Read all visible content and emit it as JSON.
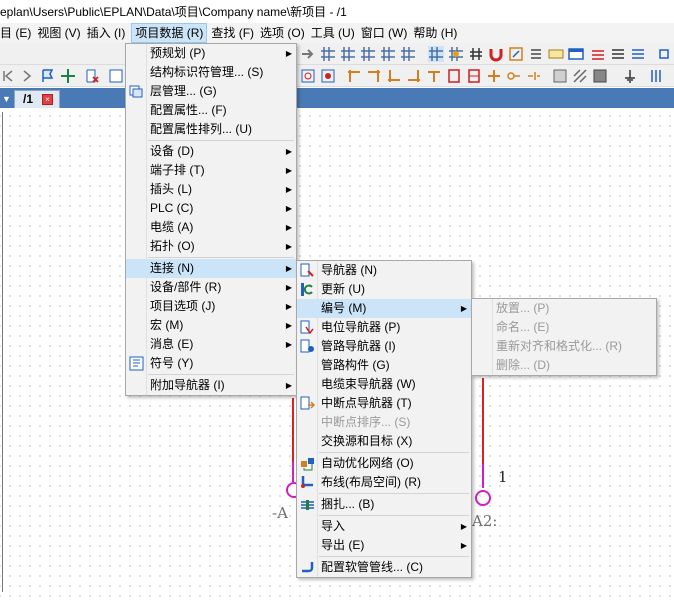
{
  "titlebar": {
    "text": "eplan\\Users\\Public\\EPLAN\\Data\\项目\\Company name\\新项目 - /1"
  },
  "menubar": {
    "items": [
      "目 (E)",
      "视图 (V)",
      "插入 (I)",
      "项目数据 (R)",
      "查找 (F)",
      "选项 (O)",
      "工具 (U)",
      "窗口 (W)",
      "帮助 (H)"
    ]
  },
  "tab": {
    "label": "/1"
  },
  "project_menu": {
    "items": [
      {
        "label": "预规划 (P)",
        "submenu": true
      },
      {
        "label": "结构标识符管理... (S)"
      },
      {
        "label": "层管理... (G)",
        "icon": "layer-icon"
      },
      {
        "label": "配置属性... (F)"
      },
      {
        "label": "配置属性排列... (U)"
      },
      {
        "label": "设备 (D)",
        "submenu": true
      },
      {
        "label": "端子排 (T)",
        "submenu": true
      },
      {
        "label": "插头 (L)",
        "submenu": true
      },
      {
        "label": "PLC (C)",
        "submenu": true
      },
      {
        "label": "电缆 (A)",
        "submenu": true
      },
      {
        "label": "拓扑 (O)",
        "submenu": true
      },
      {
        "label": "连接 (N)",
        "submenu": true
      },
      {
        "label": "设备/部件 (R)",
        "submenu": true
      },
      {
        "label": "项目选项 (J)",
        "submenu": true
      },
      {
        "label": "宏 (M)",
        "submenu": true
      },
      {
        "label": "消息 (E)",
        "submenu": true
      },
      {
        "label": "符号 (Y)",
        "icon": "symbol-icon"
      },
      {
        "label": "附加导航器 (I)",
        "submenu": true
      }
    ]
  },
  "connection_menu": {
    "items": [
      {
        "label": "导航器 (N)",
        "icon": "navigator-icon"
      },
      {
        "label": "更新 (U)",
        "icon": "refresh-icon"
      },
      {
        "label": "编号 (M)",
        "submenu": true
      },
      {
        "label": "电位导航器 (P)",
        "icon": "potential-icon"
      },
      {
        "label": "管路导航器 (I)",
        "icon": "pipe-icon"
      },
      {
        "label": "管路构件 (G)"
      },
      {
        "label": "电缆束导航器 (W)"
      },
      {
        "label": "中断点导航器 (T)",
        "icon": "interruption-icon"
      },
      {
        "label": "中断点排序... (S)",
        "disabled": true
      },
      {
        "label": "交换源和目标 (X)"
      },
      {
        "label": "自动优化网络 (O)",
        "icon": "optimize-icon"
      },
      {
        "label": "布线(布局空间) (R)",
        "icon": "routing-icon"
      },
      {
        "label": "捆扎... (B)",
        "icon": "bundle-icon"
      },
      {
        "label": "导入",
        "submenu": true
      },
      {
        "label": "导出 (E)",
        "submenu": true
      },
      {
        "label": "配置软管管线... (C)",
        "icon": "hose-icon"
      }
    ]
  },
  "numbering_menu": {
    "items": [
      {
        "label": "放置... (P)",
        "disabled": true
      },
      {
        "label": "命名... (E)",
        "disabled": true
      },
      {
        "label": "重新对齐和格式化... (R)",
        "disabled": true
      },
      {
        "label": "删除... (D)",
        "disabled": true
      }
    ]
  },
  "schematic": {
    "pin_label": "1",
    "left_text": "-A",
    "right_text": "A2:"
  },
  "colors": {
    "highlight": "#cce4f7",
    "wire": "#e02020",
    "pin": "#d020c0",
    "tab_bar": "#4a7ab5"
  }
}
